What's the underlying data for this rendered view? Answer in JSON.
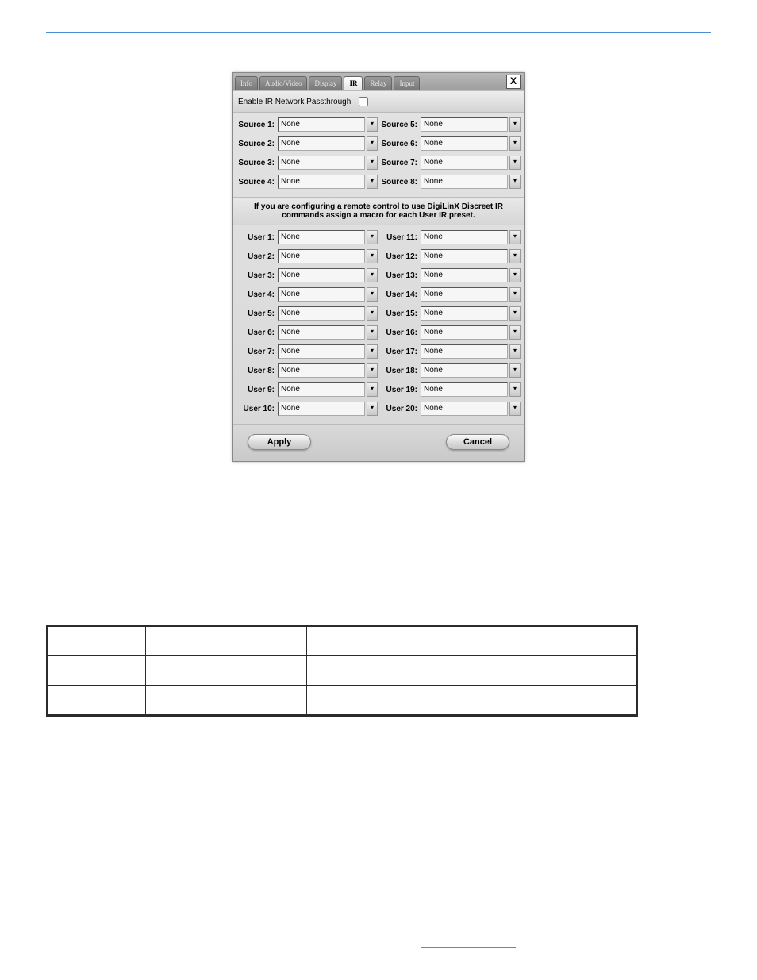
{
  "tabs": {
    "info": "Info",
    "av": "Audio/Video",
    "display": "Display",
    "ir": "IR",
    "relay": "Relay",
    "input": "Input"
  },
  "close_label": "X",
  "passthrough_label": "Enable IR Network Passthrough",
  "sources": [
    {
      "label": "Source 1:",
      "value": "None"
    },
    {
      "label": "Source 2:",
      "value": "None"
    },
    {
      "label": "Source 3:",
      "value": "None"
    },
    {
      "label": "Source 4:",
      "value": "None"
    },
    {
      "label": "Source 5:",
      "value": "None"
    },
    {
      "label": "Source 6:",
      "value": "None"
    },
    {
      "label": "Source 7:",
      "value": "None"
    },
    {
      "label": "Source 8:",
      "value": "None"
    }
  ],
  "instruction": "If you are configuring a remote control to use DigiLinX Discreet IR commands assign a macro for each User IR preset.",
  "users_left": [
    {
      "label": "User 1:",
      "value": "None"
    },
    {
      "label": "User 2:",
      "value": "None"
    },
    {
      "label": "User 3:",
      "value": "None"
    },
    {
      "label": "User 4:",
      "value": "None"
    },
    {
      "label": "User 5:",
      "value": "None"
    },
    {
      "label": "User 6:",
      "value": "None"
    },
    {
      "label": "User 7:",
      "value": "None"
    },
    {
      "label": "User 8:",
      "value": "None"
    },
    {
      "label": "User 9:",
      "value": "None"
    },
    {
      "label": "User 10:",
      "value": "None"
    }
  ],
  "users_right": [
    {
      "label": "User 11:",
      "value": "None"
    },
    {
      "label": "User 12:",
      "value": "None"
    },
    {
      "label": "User 13:",
      "value": "None"
    },
    {
      "label": "User 14:",
      "value": "None"
    },
    {
      "label": "User 15:",
      "value": "None"
    },
    {
      "label": "User 16:",
      "value": "None"
    },
    {
      "label": "User 17:",
      "value": "None"
    },
    {
      "label": "User 18:",
      "value": "None"
    },
    {
      "label": "User 19:",
      "value": "None"
    },
    {
      "label": "User 20:",
      "value": "None"
    }
  ],
  "buttons": {
    "apply": "Apply",
    "cancel": "Cancel"
  },
  "dropdown_glyph": "▾"
}
